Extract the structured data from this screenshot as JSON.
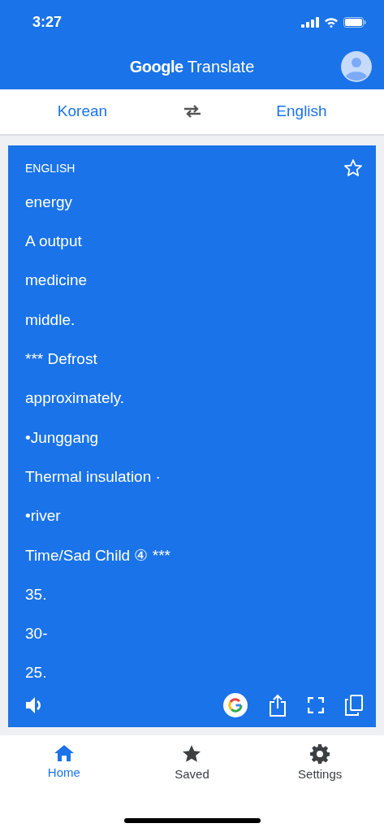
{
  "status_bar": {
    "time": "3:27"
  },
  "header": {
    "title_brand": "Google",
    "title_product": "Translate"
  },
  "languages": {
    "source": "Korean",
    "target": "English"
  },
  "result": {
    "language_label": "ENGLISH",
    "starred": false,
    "lines": [
      "energy",
      "A output",
      "medicine",
      "middle.",
      "*** Defrost",
      "approximately.",
      "•Junggang",
      "Thermal insulation ·",
      "•river",
      "Time/Sad Child ④ ***",
      "35.",
      "30-",
      "25."
    ]
  },
  "nav": [
    {
      "label": "Home",
      "kind": "home",
      "selected": true
    },
    {
      "label": "Saved",
      "kind": "saved",
      "selected": false
    },
    {
      "label": "Settings",
      "kind": "settings",
      "selected": false
    }
  ]
}
